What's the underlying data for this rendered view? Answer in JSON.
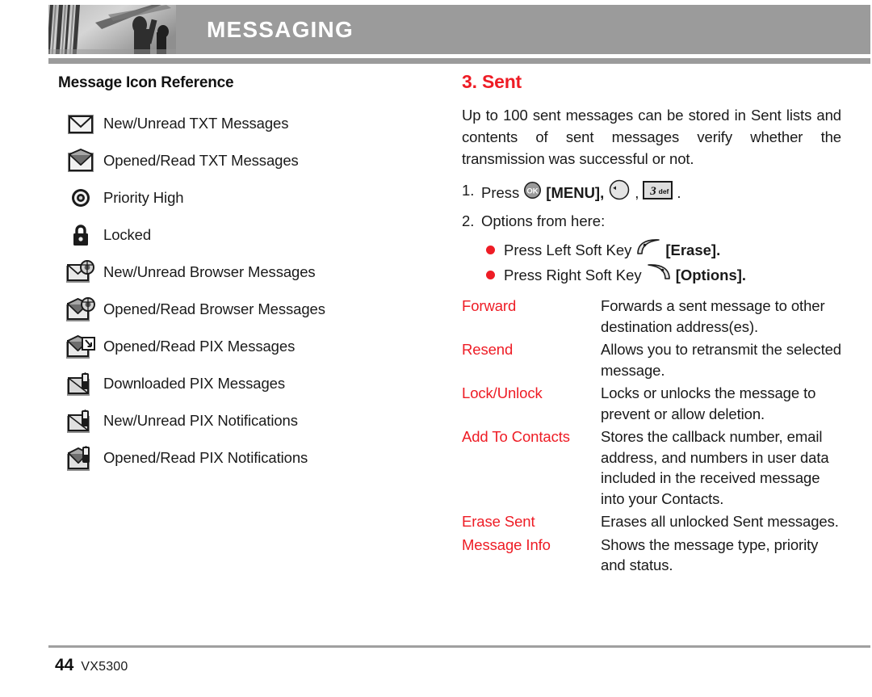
{
  "header": {
    "title": "MESSAGING",
    "banner_icon": "pillars-photo",
    "bar_color": "#9b9b9b"
  },
  "left_column": {
    "section_title": "Message Icon Reference",
    "items": [
      {
        "icon": "envelope-closed-icon",
        "label": "New/Unread TXT Messages"
      },
      {
        "icon": "envelope-open-icon",
        "label": "Opened/Read TXT Messages"
      },
      {
        "icon": "priority-high-icon",
        "label": "Priority High"
      },
      {
        "icon": "padlock-icon",
        "label": "Locked"
      },
      {
        "icon": "envelope-globe-closed-icon",
        "label": "New/Unread Browser Messages"
      },
      {
        "icon": "envelope-globe-open-icon",
        "label": "Opened/Read Browser Messages"
      },
      {
        "icon": "envelope-pix-open-icon",
        "label": "Opened/Read PIX Messages"
      },
      {
        "icon": "envelope-download-icon",
        "label": "Downloaded PIX Messages"
      },
      {
        "icon": "envelope-notify-closed-icon",
        "label": "New/Unread PIX Notifications"
      },
      {
        "icon": "envelope-notify-open-icon",
        "label": "Opened/Read PIX Notifications"
      }
    ]
  },
  "right_column": {
    "title": "3. Sent",
    "title_color": "#ee1c25",
    "intro": "Up to 100 sent messages can be stored in Sent lists and contents of sent messages verify whether the transmission was successful or not.",
    "steps": [
      {
        "num": "1.",
        "text_before": "Press",
        "ok_key_label": "OK",
        "menu_label": "[MENU],",
        "nav_key": "nav-left-key",
        "comma": ",",
        "digit_key_number": "3",
        "digit_key_letters": "def",
        "text_after": "."
      },
      {
        "num": "2.",
        "text_before": "Options from here:"
      }
    ],
    "bullets": [
      {
        "text": "Press Left Soft Key",
        "icon": "left-soft-key-icon",
        "key_label": "[Erase]."
      },
      {
        "text": "Press Right Soft Key",
        "icon": "right-soft-key-icon",
        "key_label": "[Options]."
      }
    ],
    "options": [
      {
        "name": "Forward",
        "desc": "Forwards a sent message to other destination address(es).",
        "justify": false
      },
      {
        "name": "Resend",
        "desc": "Allows you to retransmit the selected message.",
        "justify": true
      },
      {
        "name": "Lock/Unlock",
        "desc": "Locks or unlocks the message to prevent or allow deletion.",
        "justify": false
      },
      {
        "name": "Add To Contacts",
        "desc": "Stores the callback number, email address, and numbers in user data included in the received message into your Contacts.",
        "justify": false
      },
      {
        "name": "Erase Sent",
        "desc": "Erases all unlocked Sent messages.",
        "justify": false
      },
      {
        "name": "Message Info",
        "desc": "Shows the message type, priority and status.",
        "justify": false
      }
    ]
  },
  "footer": {
    "page_number": "44",
    "model": "VX5300"
  }
}
